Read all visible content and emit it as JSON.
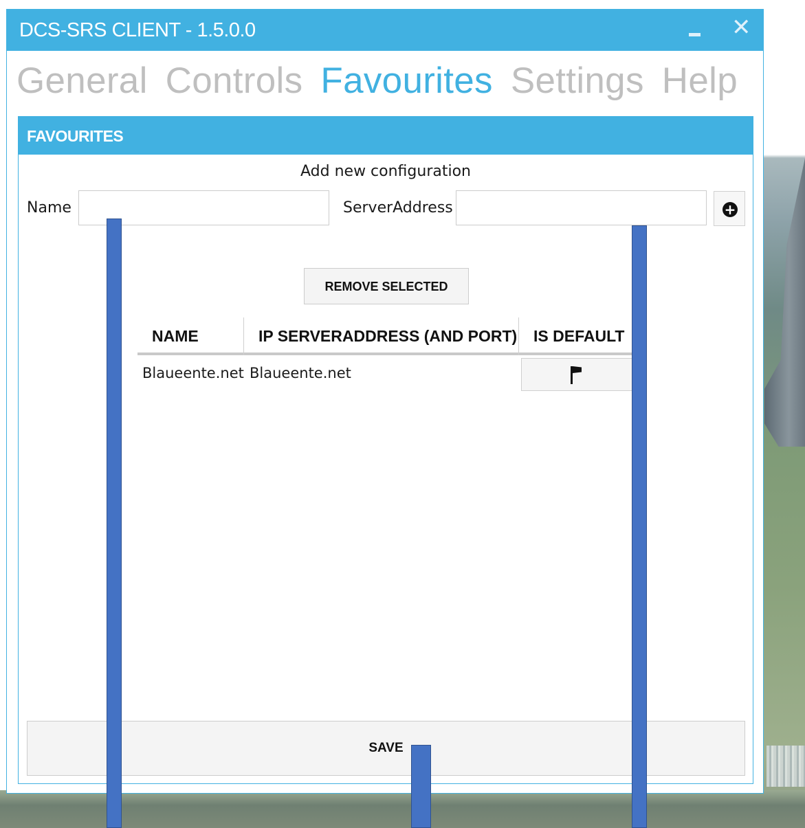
{
  "window": {
    "title": "DCS-SRS CLIENT - 1.5.0.0",
    "minimize_label": "–",
    "close_label": "✕"
  },
  "tabs": [
    {
      "label": "General",
      "active": false
    },
    {
      "label": "Controls",
      "active": false
    },
    {
      "label": "Favourites",
      "active": true
    },
    {
      "label": "Settings",
      "active": false
    },
    {
      "label": "Help",
      "active": false
    }
  ],
  "favourites": {
    "header": "FAVOURITES",
    "add_caption": "Add new configuration",
    "name_label": "Name",
    "name_value": "",
    "server_label": "ServerAddress",
    "server_value": "",
    "add_icon": "plus-circle-icon",
    "remove_label": "REMOVE SELECTED",
    "columns": [
      "NAME",
      "IP SERVERADDRESS (AND PORT)",
      "IS DEFAULT"
    ],
    "rows": [
      {
        "name": "Blaueente.net",
        "address": "Blaueente.net",
        "default_icon": "flag-icon"
      }
    ],
    "save_label": "SAVE"
  },
  "colors": {
    "accent": "#41b1e1",
    "annotation": "#4472c4",
    "inactive_tab": "#bfbfbf"
  }
}
